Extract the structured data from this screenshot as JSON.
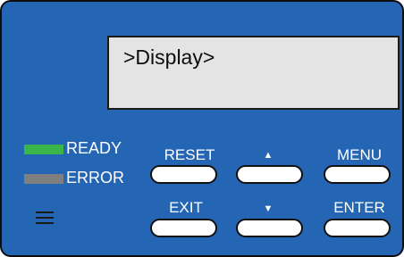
{
  "display": {
    "text": ">Display>"
  },
  "leds": [
    {
      "label": "READY",
      "color": "#39b54a"
    },
    {
      "label": "ERROR",
      "color": "#7f7f7f"
    }
  ],
  "buttons": {
    "reset": "RESET",
    "up": "▲",
    "menu": "MENU",
    "exit": "EXIT",
    "down": "▼",
    "enter": "ENTER"
  },
  "icons": {
    "hamburger": "menu-icon"
  }
}
